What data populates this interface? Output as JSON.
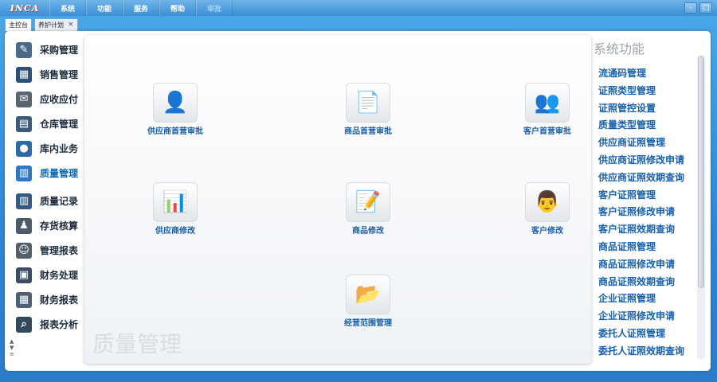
{
  "app": {
    "logo": "INCA"
  },
  "menu": [
    "系统",
    "功能",
    "服务",
    "帮助",
    "审批"
  ],
  "window_buttons": [
    "-",
    "□"
  ],
  "tabs": [
    {
      "label": "主控台"
    },
    {
      "label": "养护计划",
      "close": "×"
    }
  ],
  "nav": {
    "items": [
      {
        "label": "采购管理",
        "icon": "purchase-icon",
        "color": "#4a6a8a"
      },
      {
        "label": "销售管理",
        "icon": "sales-icon",
        "color": "#2d4f78"
      },
      {
        "label": "应收应付",
        "icon": "receivable-icon",
        "color": "#5a6470"
      },
      {
        "label": "仓库管理",
        "icon": "warehouse-icon",
        "color": "#3c5a7a"
      },
      {
        "label": "库内业务",
        "icon": "inventory-icon",
        "color": "#2e6aa8"
      },
      {
        "label": "质量管理",
        "icon": "quality-icon",
        "color": "#2f78c8"
      },
      {
        "label": "质量记录",
        "icon": "quality-record-icon",
        "color": "#345a84"
      },
      {
        "label": "存货核算",
        "icon": "stock-accounting-icon",
        "color": "#4b5b6c"
      },
      {
        "label": "管理报表",
        "icon": "management-report-icon",
        "color": "#56606a"
      },
      {
        "label": "财务处理",
        "icon": "finance-icon",
        "color": "#3b4d66"
      },
      {
        "label": "财务报表",
        "icon": "finance-report-icon",
        "color": "#4e6078"
      },
      {
        "label": "报表分析",
        "icon": "report-analysis-icon",
        "color": "#34495e"
      }
    ],
    "active": "质量管理",
    "scroll_glyphs": [
      "▲",
      "▼",
      "≡"
    ]
  },
  "content": {
    "watermark": "质量管理",
    "functions": [
      {
        "label": "供应商首营审批",
        "icon": "supplier-approval-icon",
        "glyph": "👤"
      },
      {
        "label": "商品首营审批",
        "icon": "product-approval-icon",
        "glyph": "📄"
      },
      {
        "label": "客户首营审批",
        "icon": "customer-approval-icon",
        "glyph": "👥"
      },
      {
        "label": "供应商修改",
        "icon": "supplier-edit-icon",
        "glyph": "📊"
      },
      {
        "label": "商品修改",
        "icon": "product-edit-icon",
        "glyph": "📝"
      },
      {
        "label": "客户修改",
        "icon": "customer-edit-icon",
        "glyph": "👨"
      },
      {
        "label": "经营范围管理",
        "icon": "business-scope-icon",
        "glyph": "📂"
      }
    ]
  },
  "right_panel": {
    "title": "系统功能",
    "links": [
      "流通码管理",
      "证照类型管理",
      "证照管控设置",
      "质量类型管理",
      "供应商证照管理",
      "供应商证照修改申请",
      "供应商证照效期查询",
      "客户证照管理",
      "客户证照修改申请",
      "客户证照效期查询",
      "商品证照管理",
      "商品证照修改申请",
      "商品证照效期查询",
      "企业证照管理",
      "企业证照修改申请",
      "委托人证照管理",
      "委托人证照效期查询"
    ]
  }
}
